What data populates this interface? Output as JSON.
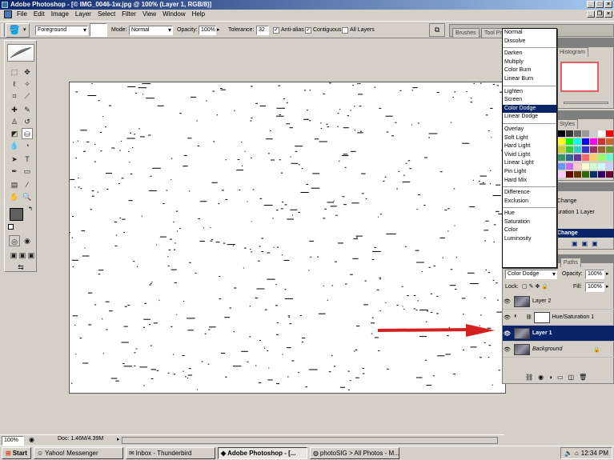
{
  "window": {
    "title": "Adobe Photoshop - [© IMG_0046-1w.jpg @ 100% (Layer 1, RGB/8)]"
  },
  "menu": [
    "File",
    "Edit",
    "Image",
    "Layer",
    "Select",
    "Filter",
    "View",
    "Window",
    "Help"
  ],
  "options": {
    "fill_source": "Foreground",
    "mode_label": "Mode:",
    "mode_value": "Normal",
    "opacity_label": "Opacity:",
    "opacity_value": "100%",
    "tolerance_label": "Tolerance:",
    "tolerance_value": "32",
    "antialias": "Anti-alias",
    "contiguous": "Contiguous",
    "all_layers": "All Layers"
  },
  "palette_well": {
    "tabs": [
      "Brushes",
      "Tool Pre"
    ]
  },
  "navigator": {
    "tab": "Histogram"
  },
  "swatches": {
    "tab": "Styles"
  },
  "history": {
    "items": [
      "Change",
      "uration 1 Layer",
      "Change"
    ]
  },
  "blend_modes": [
    [
      "Normal",
      "Dissolve"
    ],
    [
      "Darken",
      "Multiply",
      "Color Burn",
      "Linear Burn"
    ],
    [
      "Lighten",
      "Screen",
      "Color Dodge",
      "Linear Dodge"
    ],
    [
      "Overlay",
      "Soft Light",
      "Hard Light",
      "Vivid Light",
      "Linear Light",
      "Pin Light",
      "Hard Mix"
    ],
    [
      "Difference",
      "Exclusion"
    ],
    [
      "Hue",
      "Saturation",
      "Color",
      "Luminosity"
    ]
  ],
  "blend_selected": "Color Dodge",
  "layers_panel": {
    "tab": "Paths",
    "mode": "Color Dodge",
    "opacity_label": "Opacity:",
    "opacity": "100%",
    "lock_label": "Lock:",
    "fill_label": "Fill:",
    "fill": "100%",
    "layers": [
      {
        "name": "Layer 2"
      },
      {
        "name": "Hue/Saturation 1"
      },
      {
        "name": "Layer 1"
      },
      {
        "name": "Background"
      }
    ],
    "selected": "Layer 1"
  },
  "statusbar": {
    "zoom": "100%",
    "doc": "Doc: 1.46M/4.39M"
  },
  "taskbar": {
    "start": "Start",
    "tasks": [
      "Yahoo! Messenger",
      "Inbox - Thunderbird",
      "Adobe Photoshop - [...",
      "photoSIG > All Photos - M..."
    ],
    "active_task": "Adobe Photoshop - [...",
    "clock": "12:34 PM"
  },
  "colors": {
    "title_start": "#0a246a",
    "title_end": "#a6caf0",
    "selection": "#0a246a",
    "foreground_swatch": "#606060",
    "background_swatch": "#e41818",
    "arrow": "#d42020"
  }
}
